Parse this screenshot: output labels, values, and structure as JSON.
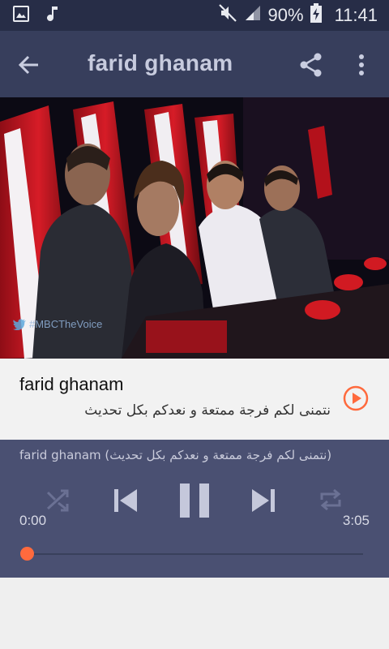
{
  "status_bar": {
    "battery": "90%",
    "time": "11:41",
    "icons": [
      "image-notification-icon",
      "music-notification-icon",
      "mute-icon",
      "signal-icon",
      "battery-charging-icon"
    ]
  },
  "toolbar": {
    "title": "farid ghanam",
    "icons": [
      "back-arrow-icon",
      "share-icon",
      "more-vert-icon"
    ]
  },
  "video": {
    "watermark": "#MBCTheVoice"
  },
  "track": {
    "title": "farid ghanam",
    "subtitle": "نتمنى لكم فرجة ممتعة و نعدكم بكل تحديث"
  },
  "player": {
    "caption": "farid ghanam (نتمنى لكم فرجة ممتعة و نعدكم بكل تحديث)",
    "current_time": "0:00",
    "duration": "3:05",
    "progress": 0,
    "controls": [
      "shuffle-icon",
      "skip-previous-icon",
      "pause-icon",
      "skip-next-icon",
      "repeat-icon"
    ]
  },
  "colors": {
    "status_bar": "#272d47",
    "toolbar": "#373e5c",
    "player": "#4a5072",
    "accent": "#ff6a3d"
  }
}
